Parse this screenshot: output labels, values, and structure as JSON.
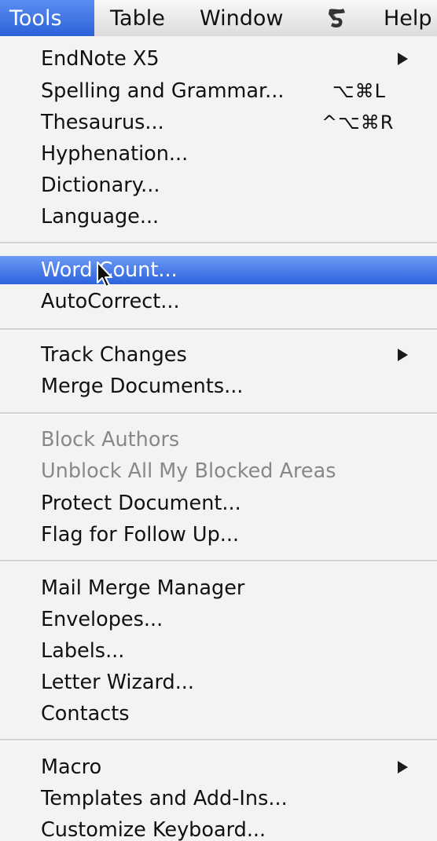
{
  "menubar": {
    "tools": "Tools",
    "table": "Table",
    "window": "Window",
    "script_icon": "applescript-icon",
    "help": "Help"
  },
  "menu": {
    "endnote": {
      "label": "EndNote X5"
    },
    "spelling": {
      "label": "Spelling and Grammar...",
      "shortcut": "⌥⌘L"
    },
    "thesaurus": {
      "label": "Thesaurus...",
      "shortcut": "^⌥⌘R"
    },
    "hyphenation": {
      "label": "Hyphenation..."
    },
    "dictionary": {
      "label": "Dictionary..."
    },
    "language": {
      "label": "Language..."
    },
    "word_count": {
      "label": "Word Count..."
    },
    "autocorrect": {
      "label": "AutoCorrect..."
    },
    "track_changes": {
      "label": "Track Changes"
    },
    "merge_documents": {
      "label": "Merge Documents..."
    },
    "block_authors": {
      "label": "Block Authors"
    },
    "unblock": {
      "label": "Unblock All My Blocked Areas"
    },
    "protect": {
      "label": "Protect Document..."
    },
    "flag": {
      "label": "Flag for Follow Up..."
    },
    "mail_merge": {
      "label": "Mail Merge Manager"
    },
    "envelopes": {
      "label": "Envelopes..."
    },
    "labels": {
      "label": "Labels..."
    },
    "letter_wizard": {
      "label": "Letter Wizard..."
    },
    "contacts": {
      "label": "Contacts"
    },
    "macro": {
      "label": "Macro"
    },
    "templates": {
      "label": "Templates and Add-Ins..."
    },
    "customize": {
      "label": "Customize Keyboard..."
    }
  },
  "colors": {
    "highlight": "#2d62dc",
    "disabled_text": "#888888",
    "menu_background": "#f3f3f3"
  }
}
